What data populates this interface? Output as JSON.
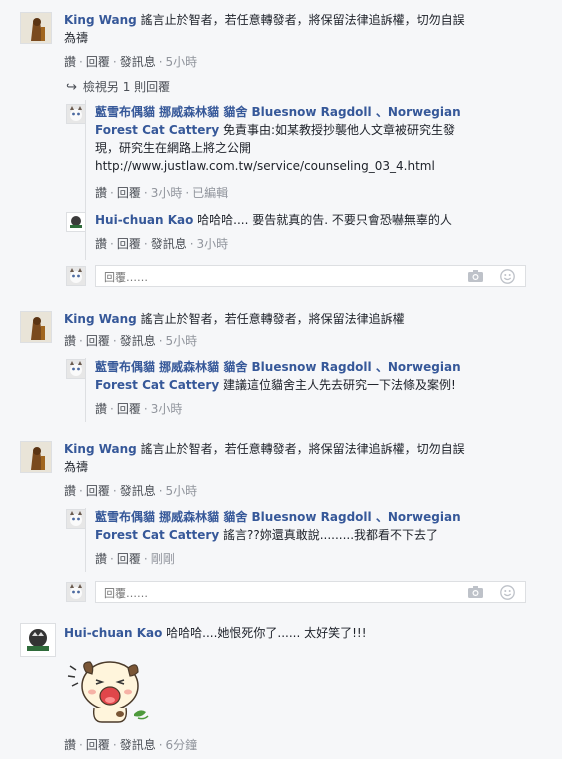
{
  "actions": {
    "like": "讚",
    "reply": "回覆",
    "message": "發訊息",
    "edited": "已編輯"
  },
  "reply_placeholder": "回覆……",
  "threads": [
    {
      "comment": {
        "name": "King Wang",
        "text": " 謠言止於智者，若任意轉發者，將保留法律追訴權，切勿自誤",
        "text2": "為禱",
        "time": "5小時"
      },
      "view_more": "檢視另 1 則回覆",
      "replies": [
        {
          "name": "藍雪布偶貓 挪威森林貓 貓舍 Bluesnow Ragdoll 、Norwegian",
          "name2": "Forest Cat Cattery",
          "text": " 免責事由:如某教授抄襲他人文章被研究生發",
          "text2": "現，研究生在網路上將之公開",
          "text3": "http://www.justlaw.com.tw/service/counseling_03_4.html",
          "time": "3小時"
        },
        {
          "name": "Hui-chuan Kao",
          "text": " 哈哈哈.... 要告就真的告. 不要只會恐嚇無辜的人",
          "time": "3小時"
        }
      ]
    },
    {
      "comment": {
        "name": "King Wang",
        "text": " 謠言止於智者，若任意轉發者，將保留法律追訴權",
        "time": "5小時"
      },
      "replies": [
        {
          "name": "藍雪布偶貓 挪威森林貓 貓舍 Bluesnow Ragdoll 、Norwegian",
          "name2": "Forest Cat Cattery",
          "text": " 建議這位貓舍主人先去研究一下法條及案例!",
          "time": "3小時"
        }
      ]
    },
    {
      "comment": {
        "name": "King Wang",
        "text": " 謠言止於智者，若任意轉發者，將保留法律追訴權，切勿自誤",
        "text2": "為禱",
        "time": "5小時"
      },
      "replies": [
        {
          "name": "藍雪布偶貓 挪威森林貓 貓舍 Bluesnow Ragdoll 、Norwegian",
          "name2": "Forest Cat Cattery",
          "text": " 謠言??妳還真敢說.........我都看不下去了",
          "time": "剛剛"
        }
      ]
    },
    {
      "comment": {
        "name": "Hui-chuan Kao",
        "text": " 哈哈哈....她恨死你了...... 太好笑了!!!",
        "time": "6分鐘"
      }
    }
  ]
}
